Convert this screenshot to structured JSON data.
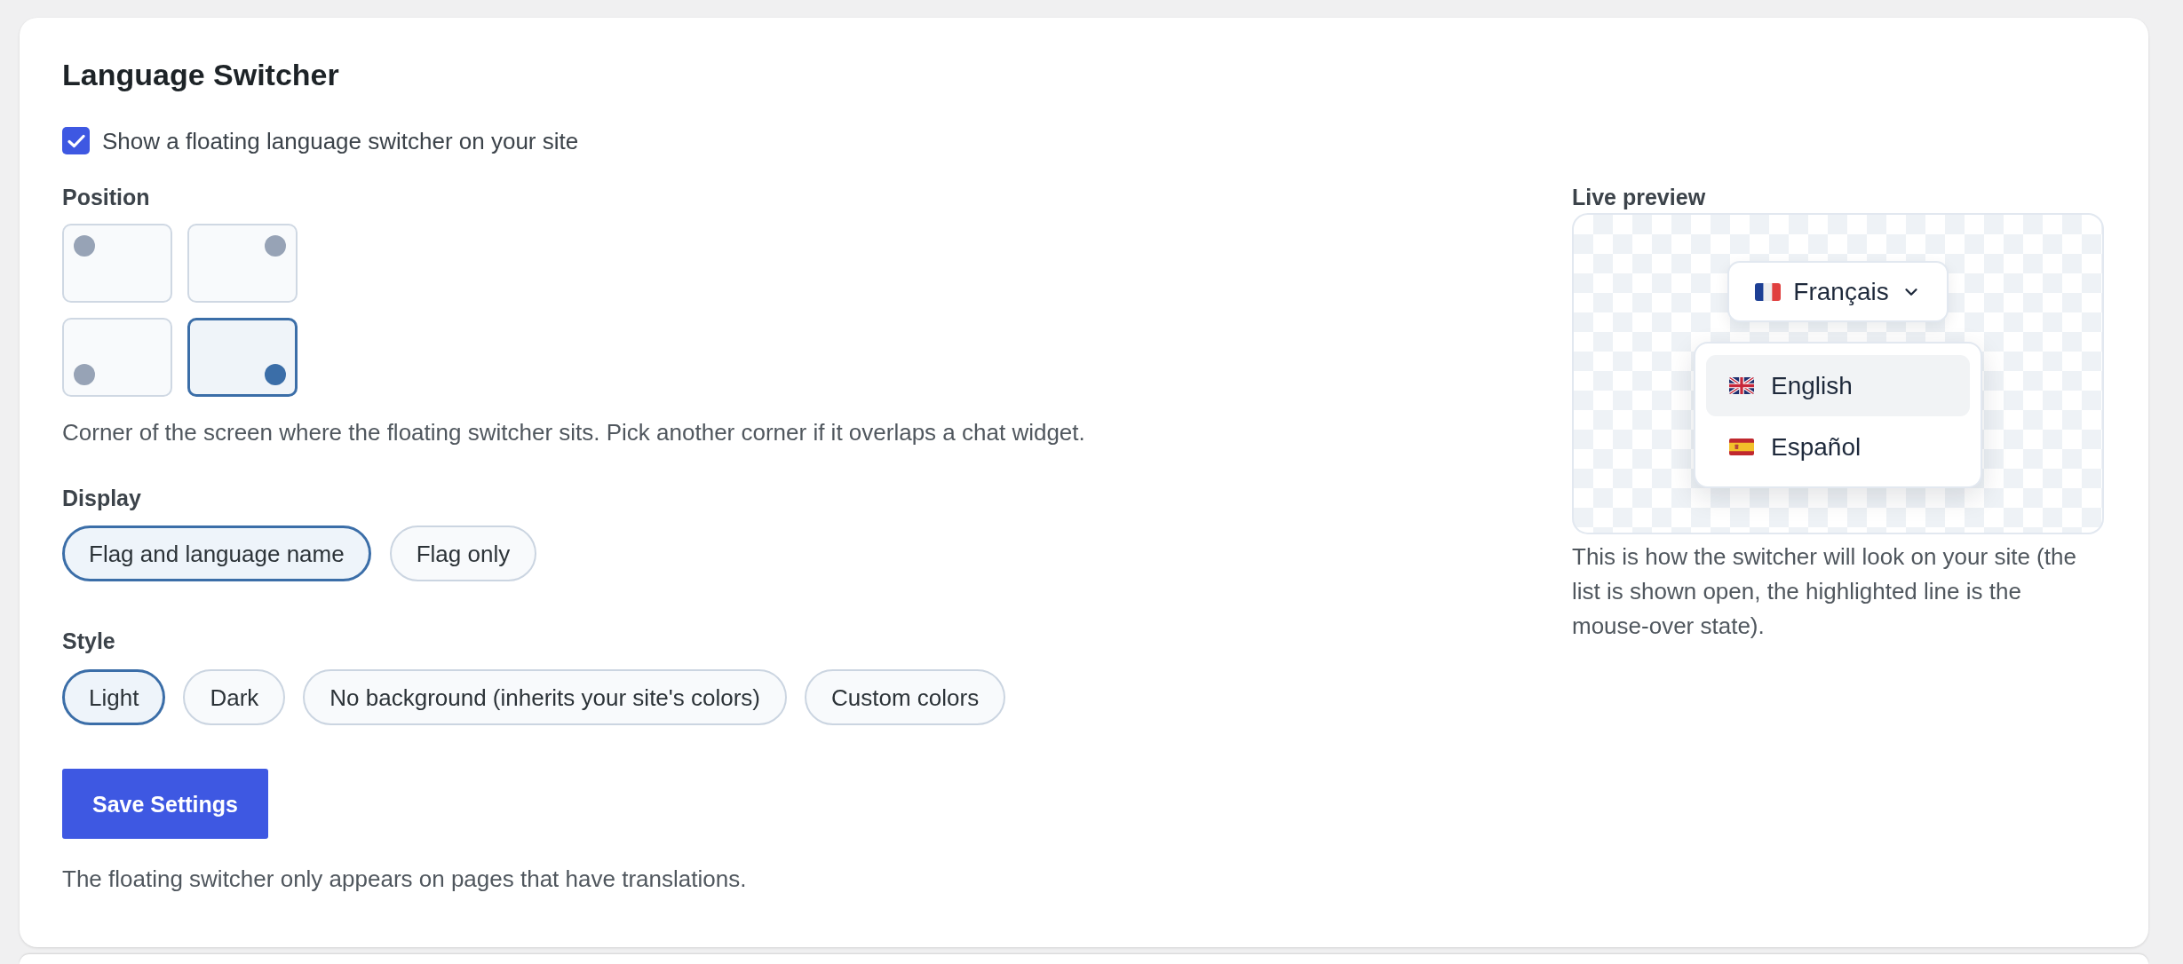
{
  "card": {
    "title": "Language Switcher"
  },
  "enable_switcher": {
    "label": "Show a floating language switcher on your site",
    "checked": true
  },
  "position": {
    "label": "Position",
    "options": [
      {
        "kind": "top-left",
        "selected": false
      },
      {
        "kind": "top-right",
        "selected": false
      },
      {
        "kind": "bottom-left",
        "selected": false
      },
      {
        "kind": "bottom-right",
        "selected": true
      }
    ],
    "help": "Corner of the screen where the floating switcher sits. Pick another corner if it overlaps a chat widget."
  },
  "display": {
    "label": "Display",
    "options": [
      {
        "label": "Flag and language name",
        "selected": true
      },
      {
        "label": "Flag only",
        "selected": false
      }
    ]
  },
  "style": {
    "label": "Style",
    "options": [
      {
        "label": "Light",
        "selected": true
      },
      {
        "label": "Dark",
        "selected": false
      },
      {
        "label": "No background (inherits your site's colors)",
        "selected": false
      },
      {
        "label": "Custom colors",
        "selected": false
      }
    ]
  },
  "save_button": {
    "label": "Save Settings"
  },
  "note": "The floating switcher only appears on pages that have translations.",
  "preview": {
    "label": "Live preview",
    "trigger": {
      "label": "Français",
      "expanded": true
    },
    "menu": [
      {
        "label": "English",
        "highlighted": true
      },
      {
        "label": "Español",
        "highlighted": false
      }
    ],
    "caption": "This is how the switcher will look on your site (the list is shown open, the highlighted line is the mouse-over state)."
  }
}
